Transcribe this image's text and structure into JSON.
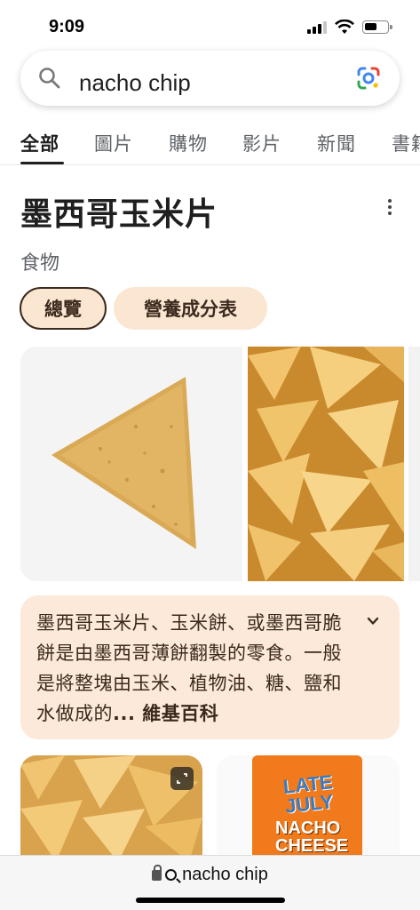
{
  "status_bar": {
    "time": "9:09"
  },
  "search": {
    "query": "nacho chip"
  },
  "tabs": [
    {
      "label": "全部",
      "active": true
    },
    {
      "label": "圖片"
    },
    {
      "label": "購物"
    },
    {
      "label": "影片"
    },
    {
      "label": "新聞"
    },
    {
      "label": "書籍"
    }
  ],
  "knowledge_panel": {
    "title": "墨西哥玉米片",
    "subtitle": "食物",
    "chips": [
      {
        "label": "總覽",
        "selected": true
      },
      {
        "label": "營養成分表"
      }
    ],
    "description": "墨西哥玉米片、玉米餅、或墨西哥脆餅是由墨西哥薄餅翻製的零食。一般是將整塊由玉米、植物油、糖、鹽和水做成的",
    "source": "... 維基百科"
  },
  "product_image": {
    "brand_line1": "LATE",
    "brand_line2": "JULY",
    "flavor_line1": "NACHO",
    "flavor_line2": "CHEESE"
  },
  "url_bar": {
    "text": "nacho chip"
  },
  "colors": {
    "chip_bg": "#fbe6d2",
    "card_bg": "#fde9d9",
    "chip_text": "#3c2a1e",
    "bag_orange": "#f07a1c"
  }
}
